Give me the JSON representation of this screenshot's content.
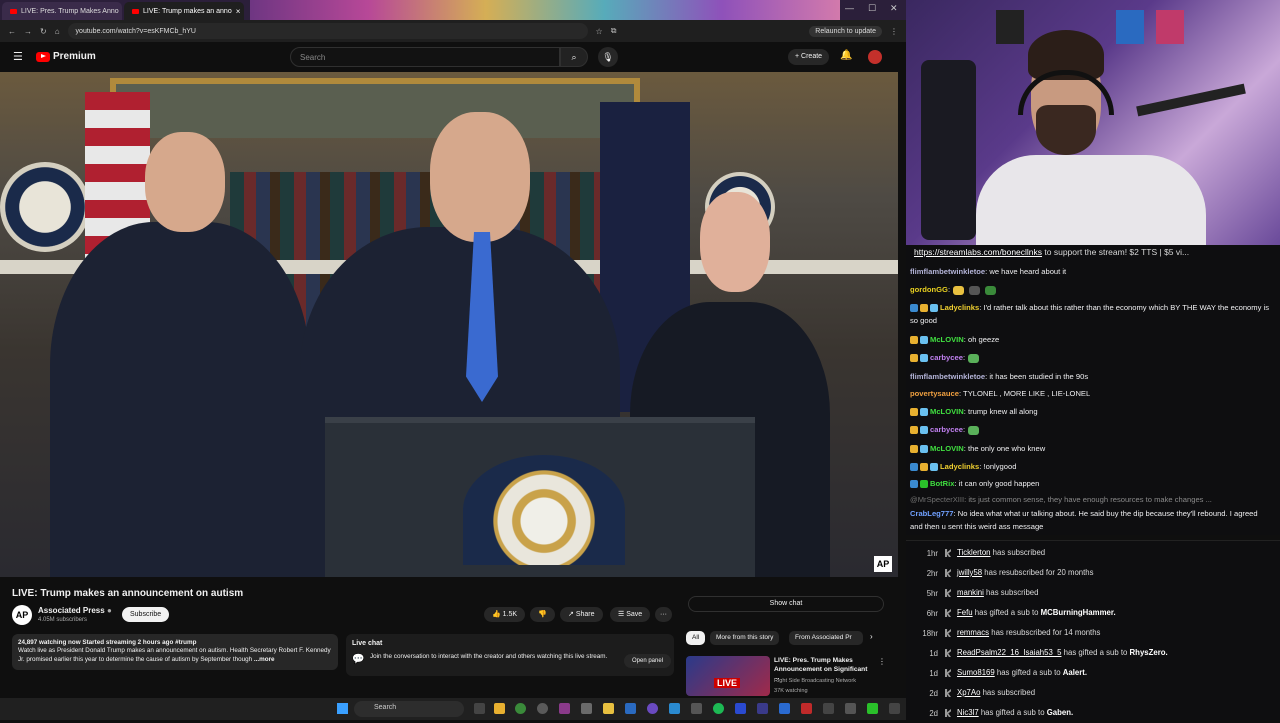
{
  "browser": {
    "tabs": [
      {
        "label": "LIVE: Pres. Trump Makes Anno",
        "active": false
      },
      {
        "label": "LIVE: Trump makes an anno",
        "active": true
      }
    ],
    "url": "youtube.com/watch?v=esKFMCb_hYU",
    "relaunch_label": "Relaunch to update"
  },
  "youtube": {
    "logo_text": "Premium",
    "search_placeholder": "Search",
    "create_label": "Create",
    "video_badge": "AP",
    "video_title": "LIVE: Trump makes an announcement on autism",
    "channel": {
      "logo": "AP",
      "name": "Associated Press",
      "subscribers": "4.05M subscribers",
      "subscribe_label": "Subscribe"
    },
    "actions": {
      "likes": "1.5K",
      "share": "Share",
      "save": "Save"
    },
    "description": {
      "stats": "24,897 watching now  Started streaming 2 hours ago  #trump",
      "text": "Watch live as President Donald Trump makes an announcement on autism. Health Secretary Robert F. Kennedy Jr. promised earlier this year to determine the cause of autism by September though",
      "more": "...more"
    },
    "live_chat": {
      "title": "Live chat",
      "text": "Join the conversation to interact with the creator and others watching this live stream.",
      "button": "Open panel"
    },
    "show_chat": "Show chat",
    "chips": [
      "All",
      "More from this story",
      "From Associated Pr"
    ],
    "recommended": {
      "live": "LIVE",
      "title": "LIVE: Pres. Trump Makes Announcement on Significant ...",
      "channel": "Right Side Broadcasting Network",
      "meta": "37K watching"
    }
  },
  "taskbar": {
    "search": "Search"
  },
  "chat": {
    "ticker": {
      "link": "https://streamlabs.com/bonecllnks",
      "text": " to support the stream! $2 TTS | $5 vi..."
    },
    "messages": [
      {
        "user": "flimflambetwinkletoe",
        "color": "#b4b4d8",
        "text": ": we have heard about it"
      },
      {
        "user": "gordonGG",
        "color": "#e8d020",
        "text": ":"
      },
      {
        "user": "Ladyclinks",
        "color": "#f0d030",
        "text": ": I'd rather talk about this rather than the economy which BY THE WAY the economy is so good"
      },
      {
        "user": "McLOVIN",
        "color": "#40e040",
        "text": ": oh geeze"
      },
      {
        "user": "carbycee",
        "color": "#c080f0",
        "text": ":"
      },
      {
        "user": "flimflambetwinkletoe",
        "color": "#b4b4d8",
        "text": ": it has been studied in the 90s"
      },
      {
        "user": "povertysauce",
        "color": "#f0a040",
        "text": ": TYLONEL , MORE LIKE , LIE-LONEL"
      },
      {
        "user": "McLOVIN",
        "color": "#40e040",
        "text": ": trump knew all along"
      },
      {
        "user": "carbycee",
        "color": "#c080f0",
        "text": ":"
      },
      {
        "user": "McLOVIN",
        "color": "#40e040",
        "text": ": the only one who knew"
      },
      {
        "user": "Ladyclinks",
        "color": "#f0d030",
        "text": ": !onlygood"
      },
      {
        "user": "BotRix",
        "color": "#40e040",
        "text": ": it can only good happen"
      },
      {
        "user": "@MrSpecterXIII",
        "color": "#707070",
        "text": ": its just common sense, they have enough resources to make changes ..."
      },
      {
        "user": "CrabLeg777",
        "color": "#70a0ff",
        "text": ": No idea what what ur talking about. He said buy the dip because they'll rebound. I agreed and then u sent this weird ass message"
      }
    ]
  },
  "events": [
    {
      "time": "1hr",
      "user": "Ticklerton",
      "text": " has subscribed",
      "recipient": ""
    },
    {
      "time": "2hr",
      "user": "jwilly58",
      "text": " has resubscribed for 20 months",
      "recipient": ""
    },
    {
      "time": "5hr",
      "user": "mankini",
      "text": " has subscribed",
      "recipient": ""
    },
    {
      "time": "6hr",
      "user": "Fefu",
      "text": " has gifted a sub to ",
      "recipient": "MCBurningHammer."
    },
    {
      "time": "18hr",
      "user": "remmacs",
      "text": " has resubscribed for 14 months",
      "recipient": ""
    },
    {
      "time": "1d",
      "user": "ReadPsalm22_16_Isaiah53_5",
      "text": " has gifted a sub to ",
      "recipient": "RhysZero."
    },
    {
      "time": "1d",
      "user": "Sumo8169",
      "text": " has gifted a sub to ",
      "recipient": "Aalert."
    },
    {
      "time": "2d",
      "user": "Xp7Ao",
      "text": " has subscribed",
      "recipient": ""
    },
    {
      "time": "2d",
      "user": "Nic3l7",
      "text": " has gifted a sub to ",
      "recipient": "Gaben."
    }
  ],
  "colors": {
    "yt_red": "#ff0000",
    "chat_bg": "#0e0e10",
    "page_bg": "#0f0f0f"
  }
}
